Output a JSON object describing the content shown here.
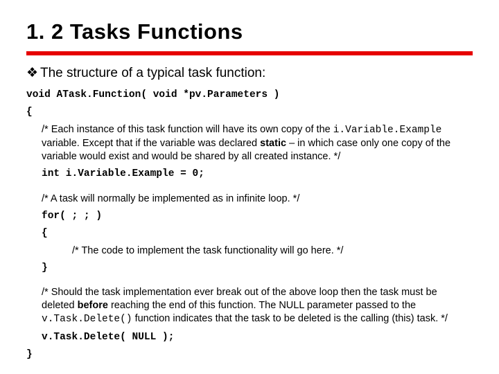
{
  "title": "1. 2 Tasks Functions",
  "bullet": "The structure of a typical task function:",
  "sig": "void ATask.Function( void *pv.Parameters )",
  "brace_open": "{",
  "c1_a": "/* Each instance of this task function will have its own copy of the ",
  "c1_code": "i.Variable.Example",
  "c1_b": "variable. Except that if the variable was declared ",
  "c1_static": "static",
  "c1_c": " – in which case only one copy of the variable would exist and would be shared by all created instance. */",
  "decl": "int i.Variable.Example = 0;",
  "c2": "/* A task will normally be implemented as in infinite loop. */",
  "for": "for( ; ; )",
  "for_open": "{",
  "c3": "/* The code to implement the task functionality will go here. */",
  "for_close": "}",
  "c4_a": "/* Should the task implementation ever break out of the above loop then the task must be deleted ",
  "c4_before": "before",
  "c4_b": " reaching the end of this function. The NULL parameter passed to the ",
  "c4_code": "v.Task.Delete()",
  "c4_c": " function indicates that the task to be deleted is the calling (this) task. */",
  "del": "v.Task.Delete( NULL );",
  "brace_close": "}"
}
